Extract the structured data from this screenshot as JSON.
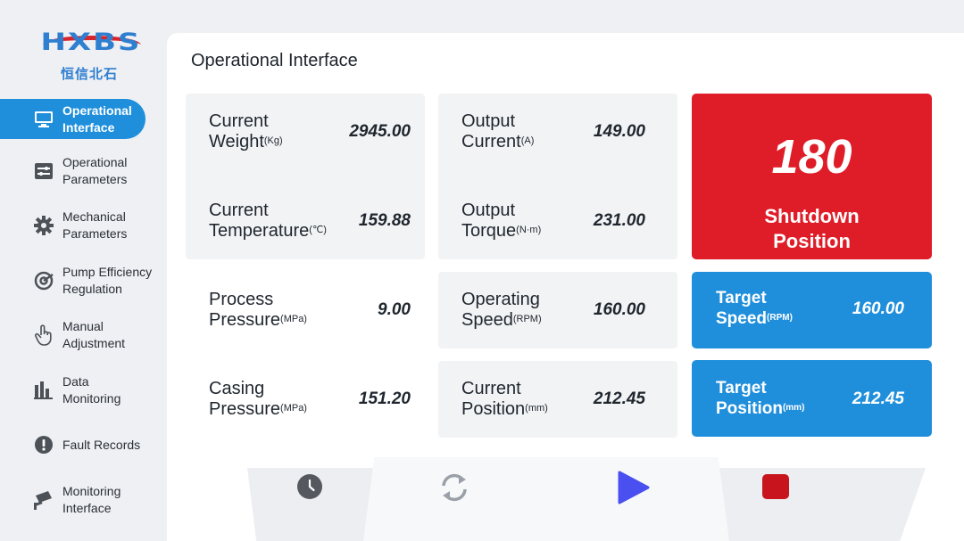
{
  "brand": {
    "logo_text": "HXBS",
    "logo_sub": "恒信北石"
  },
  "sidebar": {
    "items": [
      {
        "label": "Operational\nInterface",
        "icon": "monitor-icon",
        "active": true
      },
      {
        "label": "Operational\nParameters",
        "icon": "sliders-icon",
        "active": false
      },
      {
        "label": "Mechanical\nParameters",
        "icon": "gear-icon",
        "active": false
      },
      {
        "label": "Pump Efficiency\nRegulation",
        "icon": "target-icon",
        "active": false
      },
      {
        "label": "Manual\nAdjustment",
        "icon": "hand-pointer-icon",
        "active": false
      },
      {
        "label": "Data\nMonitoring",
        "icon": "bar-chart-icon",
        "active": false
      },
      {
        "label": "Fault Records",
        "icon": "alert-icon",
        "active": false
      },
      {
        "label": "Monitoring\nInterface",
        "icon": "camera-icon",
        "active": false
      }
    ]
  },
  "main": {
    "title": "Operational Interface",
    "metrics": {
      "current_weight": {
        "label": "Current\nWeight",
        "unit": "(Kg)",
        "value": "2945.00"
      },
      "current_temperature": {
        "label": "Current\nTemperature",
        "unit": "(℃)",
        "value": "159.88"
      },
      "process_pressure": {
        "label": "Process\nPressure",
        "unit": "(MPa)",
        "value": "9.00"
      },
      "casing_pressure": {
        "label": "Casing\nPressure",
        "unit": "(MPa)",
        "value": "151.20"
      },
      "output_current": {
        "label": "Output\nCurrent",
        "unit": "(A)",
        "value": "149.00"
      },
      "output_torque": {
        "label": "Output\nTorque",
        "unit": "(N·m)",
        "value": "231.00"
      },
      "operating_speed": {
        "label": "Operating\nSpeed",
        "unit": "(RPM)",
        "value": "160.00"
      },
      "current_position": {
        "label": "Current\nPosition",
        "unit": "(mm)",
        "value": "212.45"
      }
    },
    "shutdown": {
      "value": "180",
      "label": "Shutdown\nPosition",
      "color": "#df1d28"
    },
    "target_speed": {
      "label": "Target\nSpeed",
      "unit": "(RPM)",
      "value": "160.00",
      "color": "#208fdb"
    },
    "target_position": {
      "label": "Target\nPosition",
      "unit": "(mm)",
      "value": "212.45",
      "color": "#208fdb"
    }
  },
  "controls": {
    "history": {
      "icon": "clock-icon"
    },
    "reset": {
      "icon": "refresh-icon"
    },
    "start": {
      "icon": "play-icon",
      "color": "#4a4ff0"
    },
    "stop": {
      "icon": "stop-icon",
      "color": "#c8141c"
    }
  }
}
